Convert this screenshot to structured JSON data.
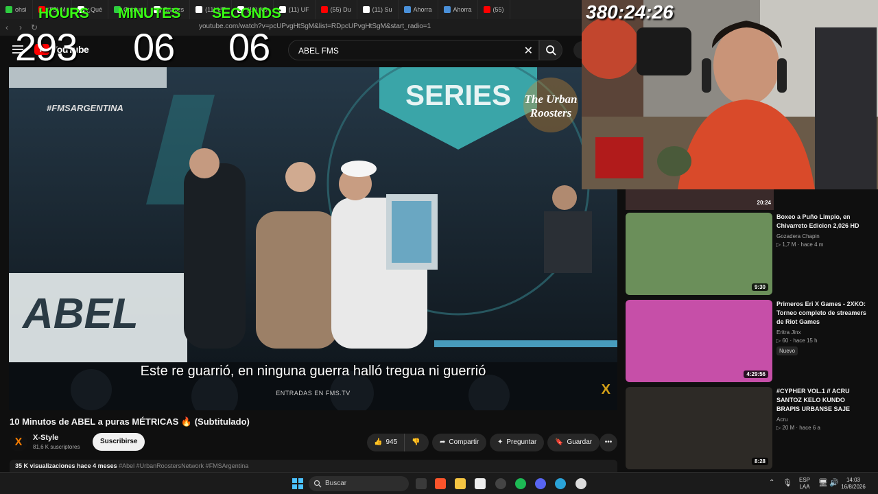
{
  "browser": {
    "tabs": [
      {
        "label": "ohsi",
        "color": "#2ecc40"
      },
      {
        "label": "(55) M",
        "color": "#ff0000"
      },
      {
        "label": "¿Qué",
        "color": "#ffffff"
      },
      {
        "label": "Captur",
        "color": "#2ecc40"
      },
      {
        "label": "Snapcs",
        "color": "#ffffff"
      },
      {
        "label": "(11) UF",
        "color": "#ffffff"
      },
      {
        "label": "(11) AC",
        "color": "#ffffff"
      },
      {
        "label": "(11) UF",
        "color": "#ffffff"
      },
      {
        "label": "(55) Du",
        "color": "#ff0000"
      },
      {
        "label": "(11) Su",
        "color": "#ffffff"
      },
      {
        "label": "Ahorra",
        "color": "#4a90d9"
      },
      {
        "label": "Ahorra",
        "color": "#4a90d9"
      },
      {
        "label": "(55)",
        "color": "#ff0000"
      }
    ],
    "url": "youtube.com/watch?v=pcUPvgHtSgM&list=RDpcUPvgHtSgM&start_radio=1"
  },
  "timer": {
    "hours_label": "HOURS",
    "minutes_label": "MINUTES",
    "seconds_label": "SECONDS",
    "hours": "293",
    "minutes": "06",
    "seconds": "06",
    "total": "380:24:26"
  },
  "youtube": {
    "logo_text": "YouTube",
    "search_value": "ABEL FMS"
  },
  "video": {
    "subtitle": "Este re guarrió, en ninguna guerra halló tregua ni guerrió",
    "entradas": "ENTRADAS EN FMS.TV",
    "hashtag_overlay": "#FMSARGENTINA",
    "title": "10 Minutos de ABEL a puras MÉTRICAS 🔥 (Subtitulado)",
    "channel_name": "X-Style",
    "channel_initial": "X",
    "channel_subs": "81,6 K suscriptores",
    "subscribe_label": "Suscribirse",
    "likes": "945",
    "share_label": "Compartir",
    "ask_label": "Preguntar",
    "save_label": "Guardar",
    "views": "35 K visualizaciones",
    "date": "hace 4 meses",
    "tags": "#Abel #UrbanRoostersNetwork #FMSArgentina"
  },
  "recommendations": {
    "top_strip_duration": "20:24",
    "items": [
      {
        "title": "Boxeo a Puño Limpio, en Chivarreto Edicion 2,026 HD",
        "channel": "Gozadera Chapin",
        "views": "1,7 M",
        "age": "hace 4 m",
        "duration": "9:30",
        "badge": "",
        "thumb": "#6b8f5a"
      },
      {
        "title": "Primeros Eri X Games - 2XKO: Torneo completo de streamers de Riot Games",
        "channel": "Eritra Jinx",
        "views": "60",
        "age": "hace 15 h",
        "duration": "4:29:56",
        "badge": "Nuevo",
        "thumb": "#c64fa8"
      },
      {
        "title": "#CYPHER VOL.1 // ACRU SANTOZ KELO KUNDO BRAPIS URBANSE SAJE",
        "channel": "Acru",
        "views": "20 M",
        "age": "hace 6 a",
        "duration": "8:28",
        "badge": "",
        "thumb": "#2d2a26"
      }
    ]
  },
  "taskbar": {
    "search_label": "Buscar",
    "lang_top": "ESP",
    "lang_bottom": "LAA",
    "time": "14:03",
    "date": "16/8/2026"
  }
}
